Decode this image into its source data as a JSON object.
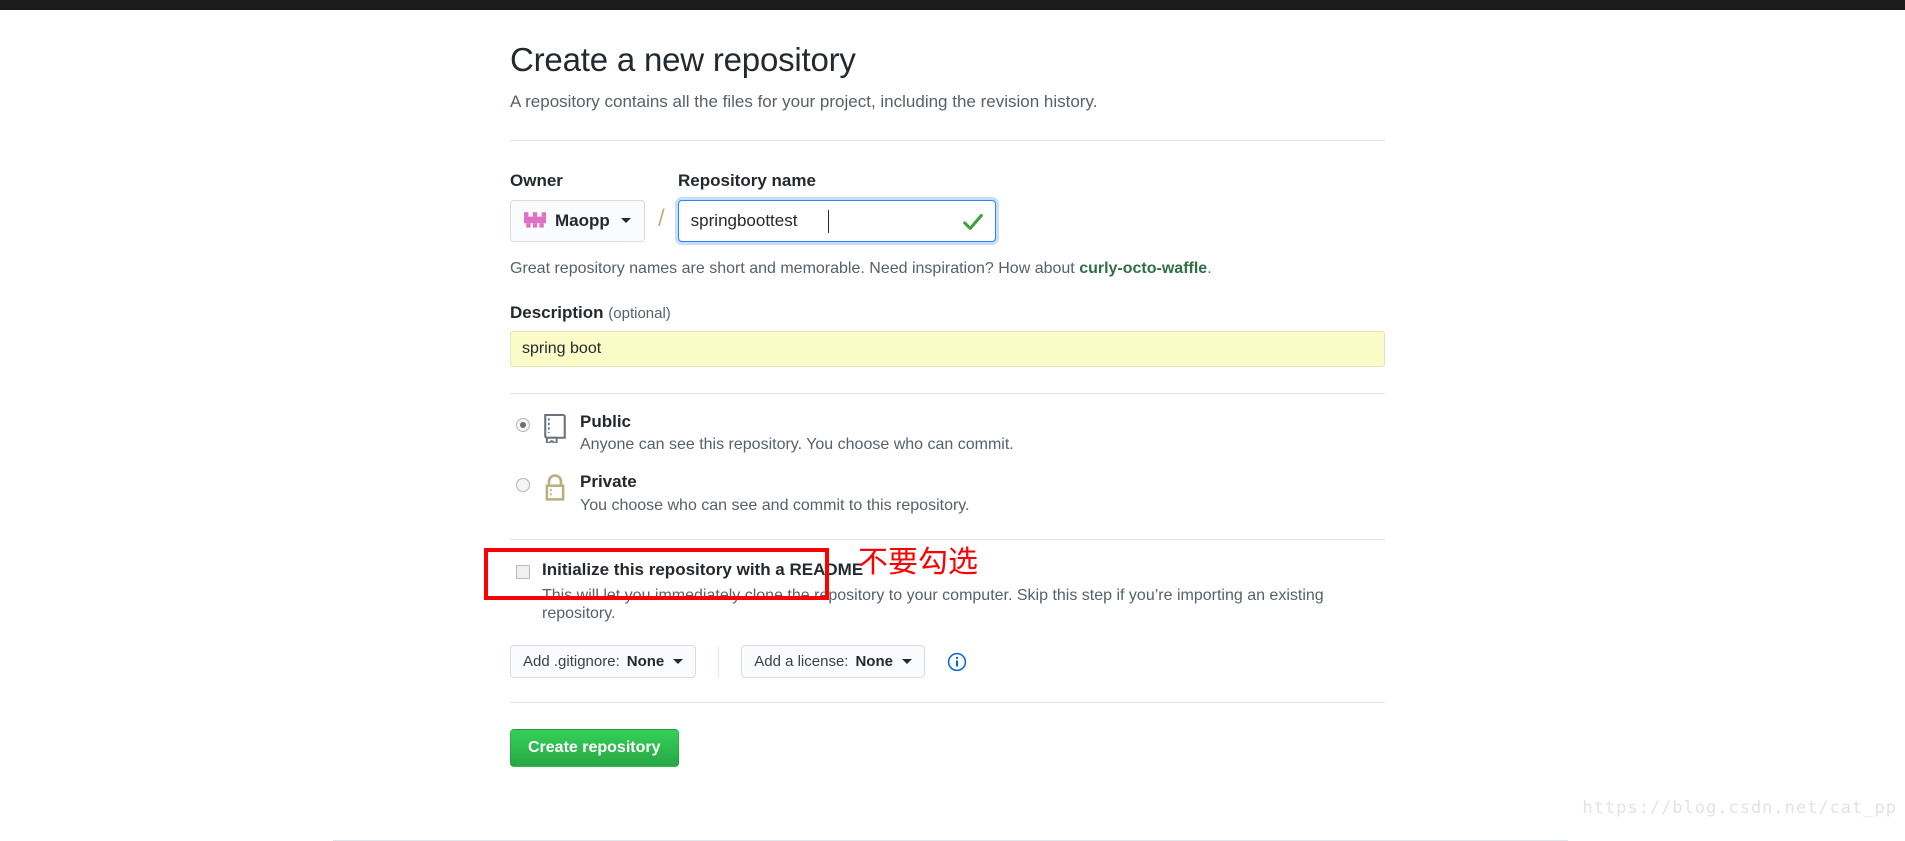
{
  "page": {
    "title": "Create a new repository",
    "subtitle": "A repository contains all the files for your project, including the revision history."
  },
  "owner": {
    "label": "Owner",
    "name": "Maopp",
    "avatar_icon": "identicon-avatar",
    "caret_icon": "chevron-down-icon"
  },
  "repository_name": {
    "label": "Repository name",
    "value": "springboottest",
    "placeholder": "",
    "separator": "/",
    "valid_icon": "check-icon"
  },
  "hint": {
    "text_before": "Great repository names are short and memorable. Need inspiration? How about ",
    "link": "curly-octo-waffle",
    "text_after": "."
  },
  "description": {
    "label": "Description",
    "optional": "(optional)",
    "value": "spring boot",
    "placeholder": ""
  },
  "visibility": {
    "options": [
      {
        "id": "public",
        "title": "Public",
        "desc": "Anyone can see this repository. You choose who can commit.",
        "icon": "repo-book-icon",
        "selected": true
      },
      {
        "id": "private",
        "title": "Private",
        "desc": "You choose who can see and commit to this repository.",
        "icon": "lock-icon",
        "selected": false
      }
    ]
  },
  "readme": {
    "title": "Initialize this repository with a README",
    "desc": "This will let you immediately clone the repository to your computer. Skip this step if you’re importing an existing repository.",
    "checked": false,
    "annotation": "不要勾选",
    "annotation_color": "#ff0000"
  },
  "options_row": {
    "gitignore": {
      "prefix": "Add .gitignore:",
      "value": "None",
      "caret_icon": "chevron-down-icon"
    },
    "license": {
      "prefix": "Add a license:",
      "value": "None",
      "caret_icon": "chevron-down-icon"
    },
    "info_icon": "info-circle-icon"
  },
  "submit": {
    "label": "Create repository",
    "color": "#2cbe4e"
  },
  "watermark": "https://blog.csdn.net/cat_pp"
}
